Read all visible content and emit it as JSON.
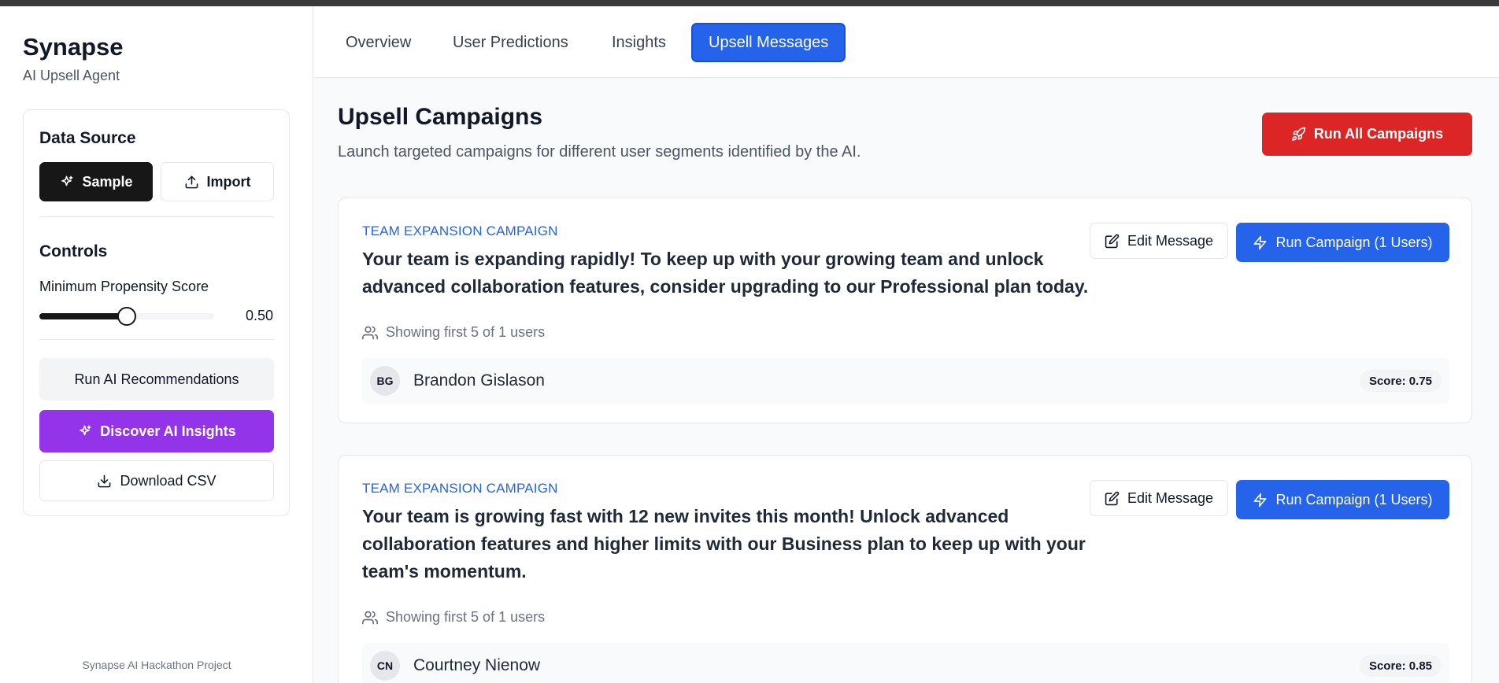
{
  "sidebar": {
    "brand_title": "Synapse",
    "brand_subtitle": "AI Upsell Agent",
    "data_source_heading": "Data Source",
    "sample_label": "Sample",
    "import_label": "Import",
    "controls_heading": "Controls",
    "slider_label": "Minimum Propensity Score",
    "slider_value_text": "0.50",
    "slider_fraction": 0.5,
    "run_ai_label": "Run AI Recommendations",
    "discover_label": "Discover AI Insights",
    "download_label": "Download CSV",
    "footer": "Synapse AI Hackathon Project"
  },
  "tabs": [
    {
      "label": "Overview",
      "active": false
    },
    {
      "label": "User Predictions",
      "active": false
    },
    {
      "label": "Insights",
      "active": false
    },
    {
      "label": "Upsell Messages",
      "active": true
    }
  ],
  "main": {
    "title": "Upsell Campaigns",
    "subtitle": "Launch targeted campaigns for different user segments identified by the AI.",
    "run_all_label": "Run All Campaigns",
    "campaigns": [
      {
        "kicker": "TEAM EXPANSION CAMPAIGN",
        "message": "Your team is expanding rapidly! To keep up with your growing team and unlock advanced collaboration features, consider upgrading to our Professional plan today.",
        "edit_label": "Edit Message",
        "run_label": "Run Campaign (1 Users)",
        "showing": "Showing first 5 of 1 users",
        "user": {
          "initials": "BG",
          "name": "Brandon Gislason",
          "score": "Score: 0.75"
        }
      },
      {
        "kicker": "TEAM EXPANSION CAMPAIGN",
        "message": "Your team is growing fast with 12 new invites this month! Unlock advanced collaboration features and higher limits with our Business plan to keep up with your team's momentum.",
        "edit_label": "Edit Message",
        "run_label": "Run Campaign (1 Users)",
        "showing": "Showing first 5 of 1 users",
        "user": {
          "initials": "CN",
          "name": "Courtney Nienow",
          "score": "Score: 0.85"
        }
      }
    ]
  },
  "colors": {
    "primary": "#2563eb",
    "danger": "#dc2626",
    "purple": "#9333ea",
    "dark": "#171717"
  }
}
